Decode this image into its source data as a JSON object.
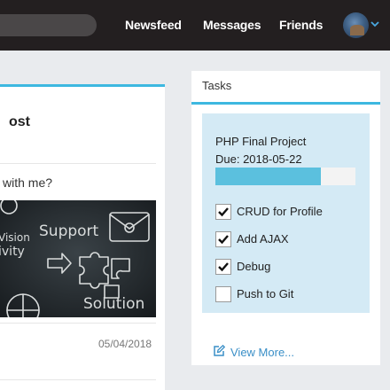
{
  "nav": {
    "links": [
      "Newsfeed",
      "Messages",
      "Friends"
    ]
  },
  "post": {
    "title": "ost",
    "text": "with me?",
    "date": "05/04/2018",
    "image_words": [
      "Support",
      "Vision",
      "ivity",
      "Solution"
    ]
  },
  "tasks": {
    "header": "Tasks",
    "project": "PHP Final Project",
    "due": "Due: 2018-05-22",
    "progress": 0.75,
    "items": [
      {
        "label": "CRUD for Profile",
        "checked": true
      },
      {
        "label": "Add AJAX",
        "checked": true
      },
      {
        "label": "Debug",
        "checked": true
      },
      {
        "label": "Push to Git",
        "checked": false
      }
    ],
    "view_more": "View More..."
  },
  "colors": {
    "topbar": "#231f20",
    "accent": "#3db8e0",
    "tasks_bg": "#d4eaf5",
    "progress_fill": "#5bc0de",
    "link": "#3a8fc7"
  }
}
